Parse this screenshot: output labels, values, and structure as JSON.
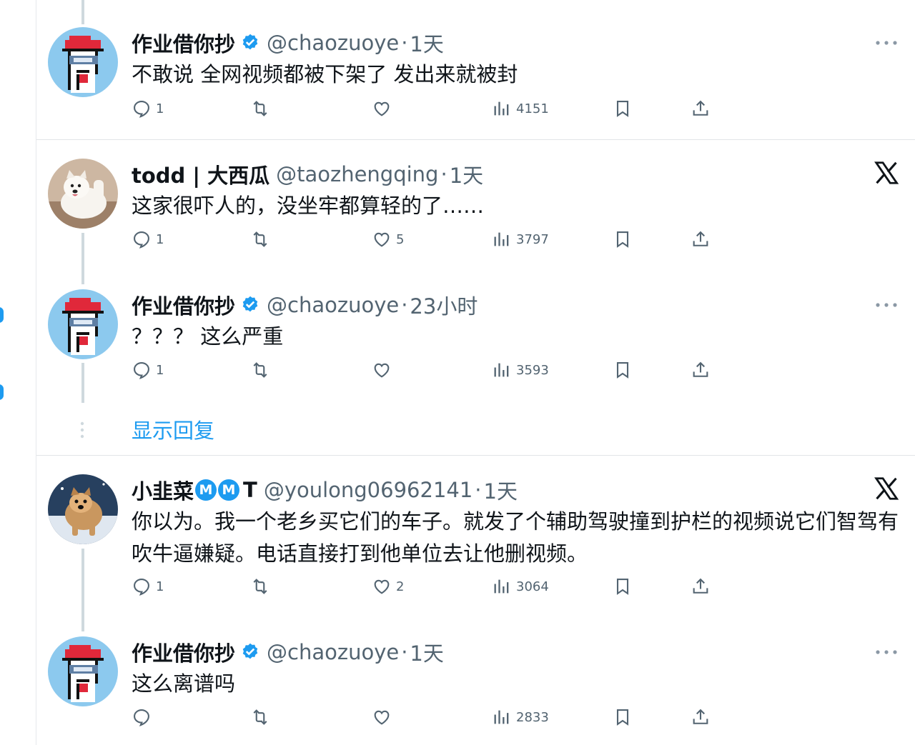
{
  "tweets": [
    {
      "name": "作业借你抄",
      "handle": "@chaozuoye",
      "time": "1天",
      "text": "不敢说 全网视频都被下架了 发出来就被封",
      "replies": "1",
      "retweets": "",
      "likes": "",
      "views": "4151",
      "verified": true,
      "top_right": "more-icon"
    },
    {
      "name": "todd | 大西瓜",
      "handle": "@taozhengqing",
      "time": "1天",
      "text": "这家很吓人的，没坐牢都算轻的了……",
      "replies": "1",
      "retweets": "",
      "likes": "5",
      "views": "3797",
      "verified": false,
      "top_right": "x-logo-icon"
    },
    {
      "name": "作业借你抄",
      "handle": "@chaozuoye",
      "time": "23小时",
      "text": "？？？ 这么严重",
      "replies": "1",
      "retweets": "",
      "likes": "",
      "views": "3593",
      "verified": true,
      "top_right": "more-icon"
    },
    {
      "name": "小韭菜",
      "name_badges": [
        "M",
        "M"
      ],
      "name_suffix": "T",
      "handle": "@youlong06962141",
      "time": "1天",
      "text": "你以为。我一个老乡买它们的车子。就发了个辅助驾驶撞到护栏的视频说它们智驾有吹牛逼嫌疑。电话直接打到他单位去让他删视频。",
      "replies": "1",
      "retweets": "",
      "likes": "2",
      "views": "3064",
      "verified": false,
      "top_right": "x-logo-icon"
    },
    {
      "name": "作业借你抄",
      "handle": "@chaozuoye",
      "time": "1天",
      "text": "这么离谱吗",
      "replies": "",
      "retweets": "",
      "likes": "",
      "views": "2833",
      "verified": true,
      "top_right": "more-icon"
    }
  ],
  "show_replies_label": "显示回复",
  "separator": "·",
  "colors": {
    "accent": "#1d9bf0",
    "secondary_text": "#536471",
    "thread_line": "#cfd9de"
  }
}
